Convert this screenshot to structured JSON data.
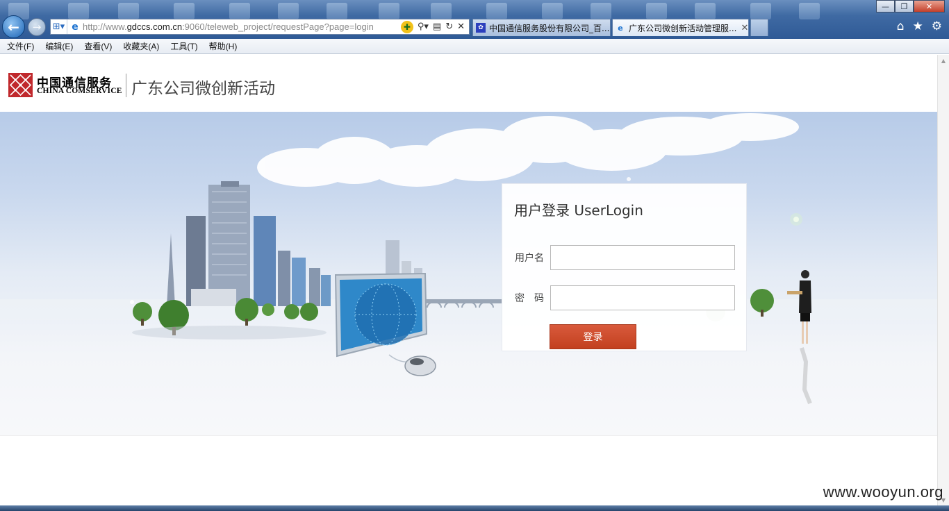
{
  "browser": {
    "address_url_prefix": "http://www.",
    "address_url_domain": "gdccs.com.cn",
    "address_url_rest": ":9060/teleweb_project/requestPage?page=login",
    "tabs": [
      {
        "label": "中国通信服务股份有限公司_百...",
        "icon": "baidu-paw-icon"
      },
      {
        "label": "广东公司微创新活动管理服...",
        "icon": "ie-page-icon"
      }
    ],
    "menu": [
      "文件(F)",
      "编辑(E)",
      "查看(V)",
      "收藏夹(A)",
      "工具(T)",
      "帮助(H)"
    ]
  },
  "header": {
    "logo_cn": "中国通信服务",
    "logo_en": "CHINA COMSERVICE",
    "site_title": "广东公司微创新活动"
  },
  "login": {
    "title": "用户登录 UserLogin",
    "username_label": "用户名",
    "password_label": "密　码",
    "username_value": "",
    "password_value": "",
    "submit_label": "登录"
  },
  "watermark": "www.wooyun.org",
  "colors": {
    "brand_red": "#c0282c",
    "button_red": "#cc4a2a",
    "chrome_blue": "#3f6aa3"
  }
}
